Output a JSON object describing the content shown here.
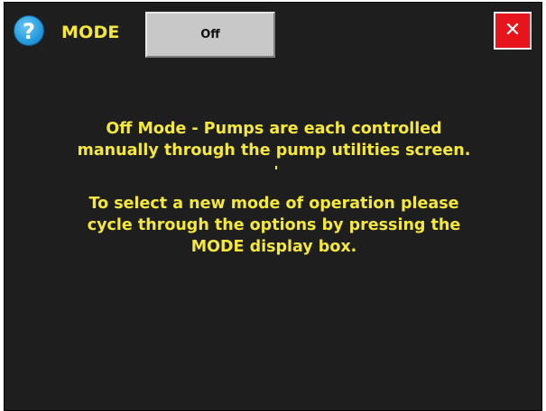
{
  "header": {
    "help_icon": {
      "icon": "question-mark-icon",
      "glyph": "?"
    },
    "mode_label": "MODE",
    "mode_value": "Off",
    "close_icon": {
      "icon": "close-icon",
      "glyph": "✕"
    }
  },
  "message": {
    "paragraph_1": [
      "Off Mode - Pumps are each controlled",
      "manually through the pump utilities screen."
    ],
    "paragraph_2": [
      "To select a new mode of operation please",
      "cycle through the options by pressing the",
      "MODE display box."
    ]
  },
  "colors": {
    "background": "#1e1e1e",
    "text": "#f4e83c",
    "mode_box": "#c8c8c8",
    "close_button": "#e8141c",
    "help_icon": "#2a9fe0"
  }
}
